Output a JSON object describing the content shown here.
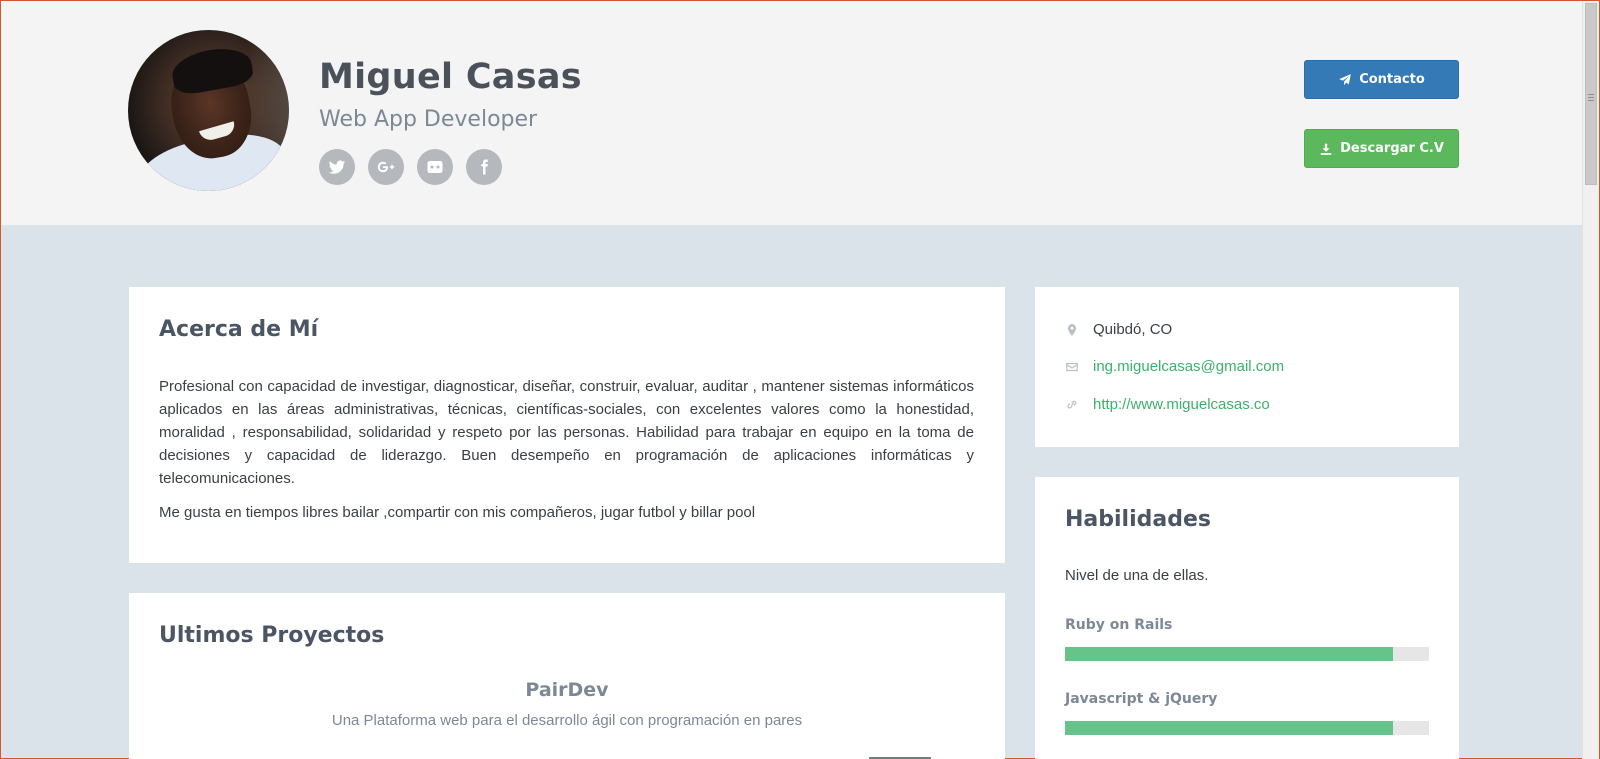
{
  "profile": {
    "name": "Miguel Casas",
    "role": "Web App Developer",
    "socials": [
      "twitter-icon",
      "google-plus-icon",
      "github-icon",
      "facebook-icon"
    ]
  },
  "actions": {
    "contact_label": "Contacto",
    "cv_label": "Descargar C.V"
  },
  "about": {
    "title": "Acerca de Mí",
    "paragraph1": "Profesional con capacidad de investigar, diagnosticar, diseñar, construir, evaluar, auditar , mantener sistemas informáticos aplicados en las áreas administrativas, técnicas, científicas-sociales, con excelentes valores como la honestidad, moralidad , responsabilidad, solidaridad y respeto por las personas. Habilidad para trabajar en equipo en la toma de decisiones y capacidad de liderazgo. Buen desempeño en programación de aplicaciones informáticas y telecomunicaciones.",
    "paragraph2": "Me gusta en tiempos libres bailar ,compartir con mis compañeros, jugar futbol y billar pool"
  },
  "projects": {
    "title": "Ultimos Proyectos",
    "items": [
      {
        "name": "PairDev",
        "description": "Una Plataforma web para el desarrollo ágil con programación en pares"
      }
    ]
  },
  "contact": {
    "location": "Quibdó, CO",
    "email": "ing.miguelcasas@gmail.com",
    "website": "http://www.miguelcasas.co"
  },
  "skills": {
    "title": "Habilidades",
    "intro": "Nivel de una de ellas.",
    "items": [
      {
        "name": "Ruby on Rails",
        "level": 0.9
      },
      {
        "name": "Javascript & jQuery",
        "level": 0.9
      }
    ]
  },
  "colors": {
    "primary": "#337ab7",
    "success": "#5cb85c",
    "link": "#3bb16c",
    "skill_fill": "#66c48a"
  }
}
